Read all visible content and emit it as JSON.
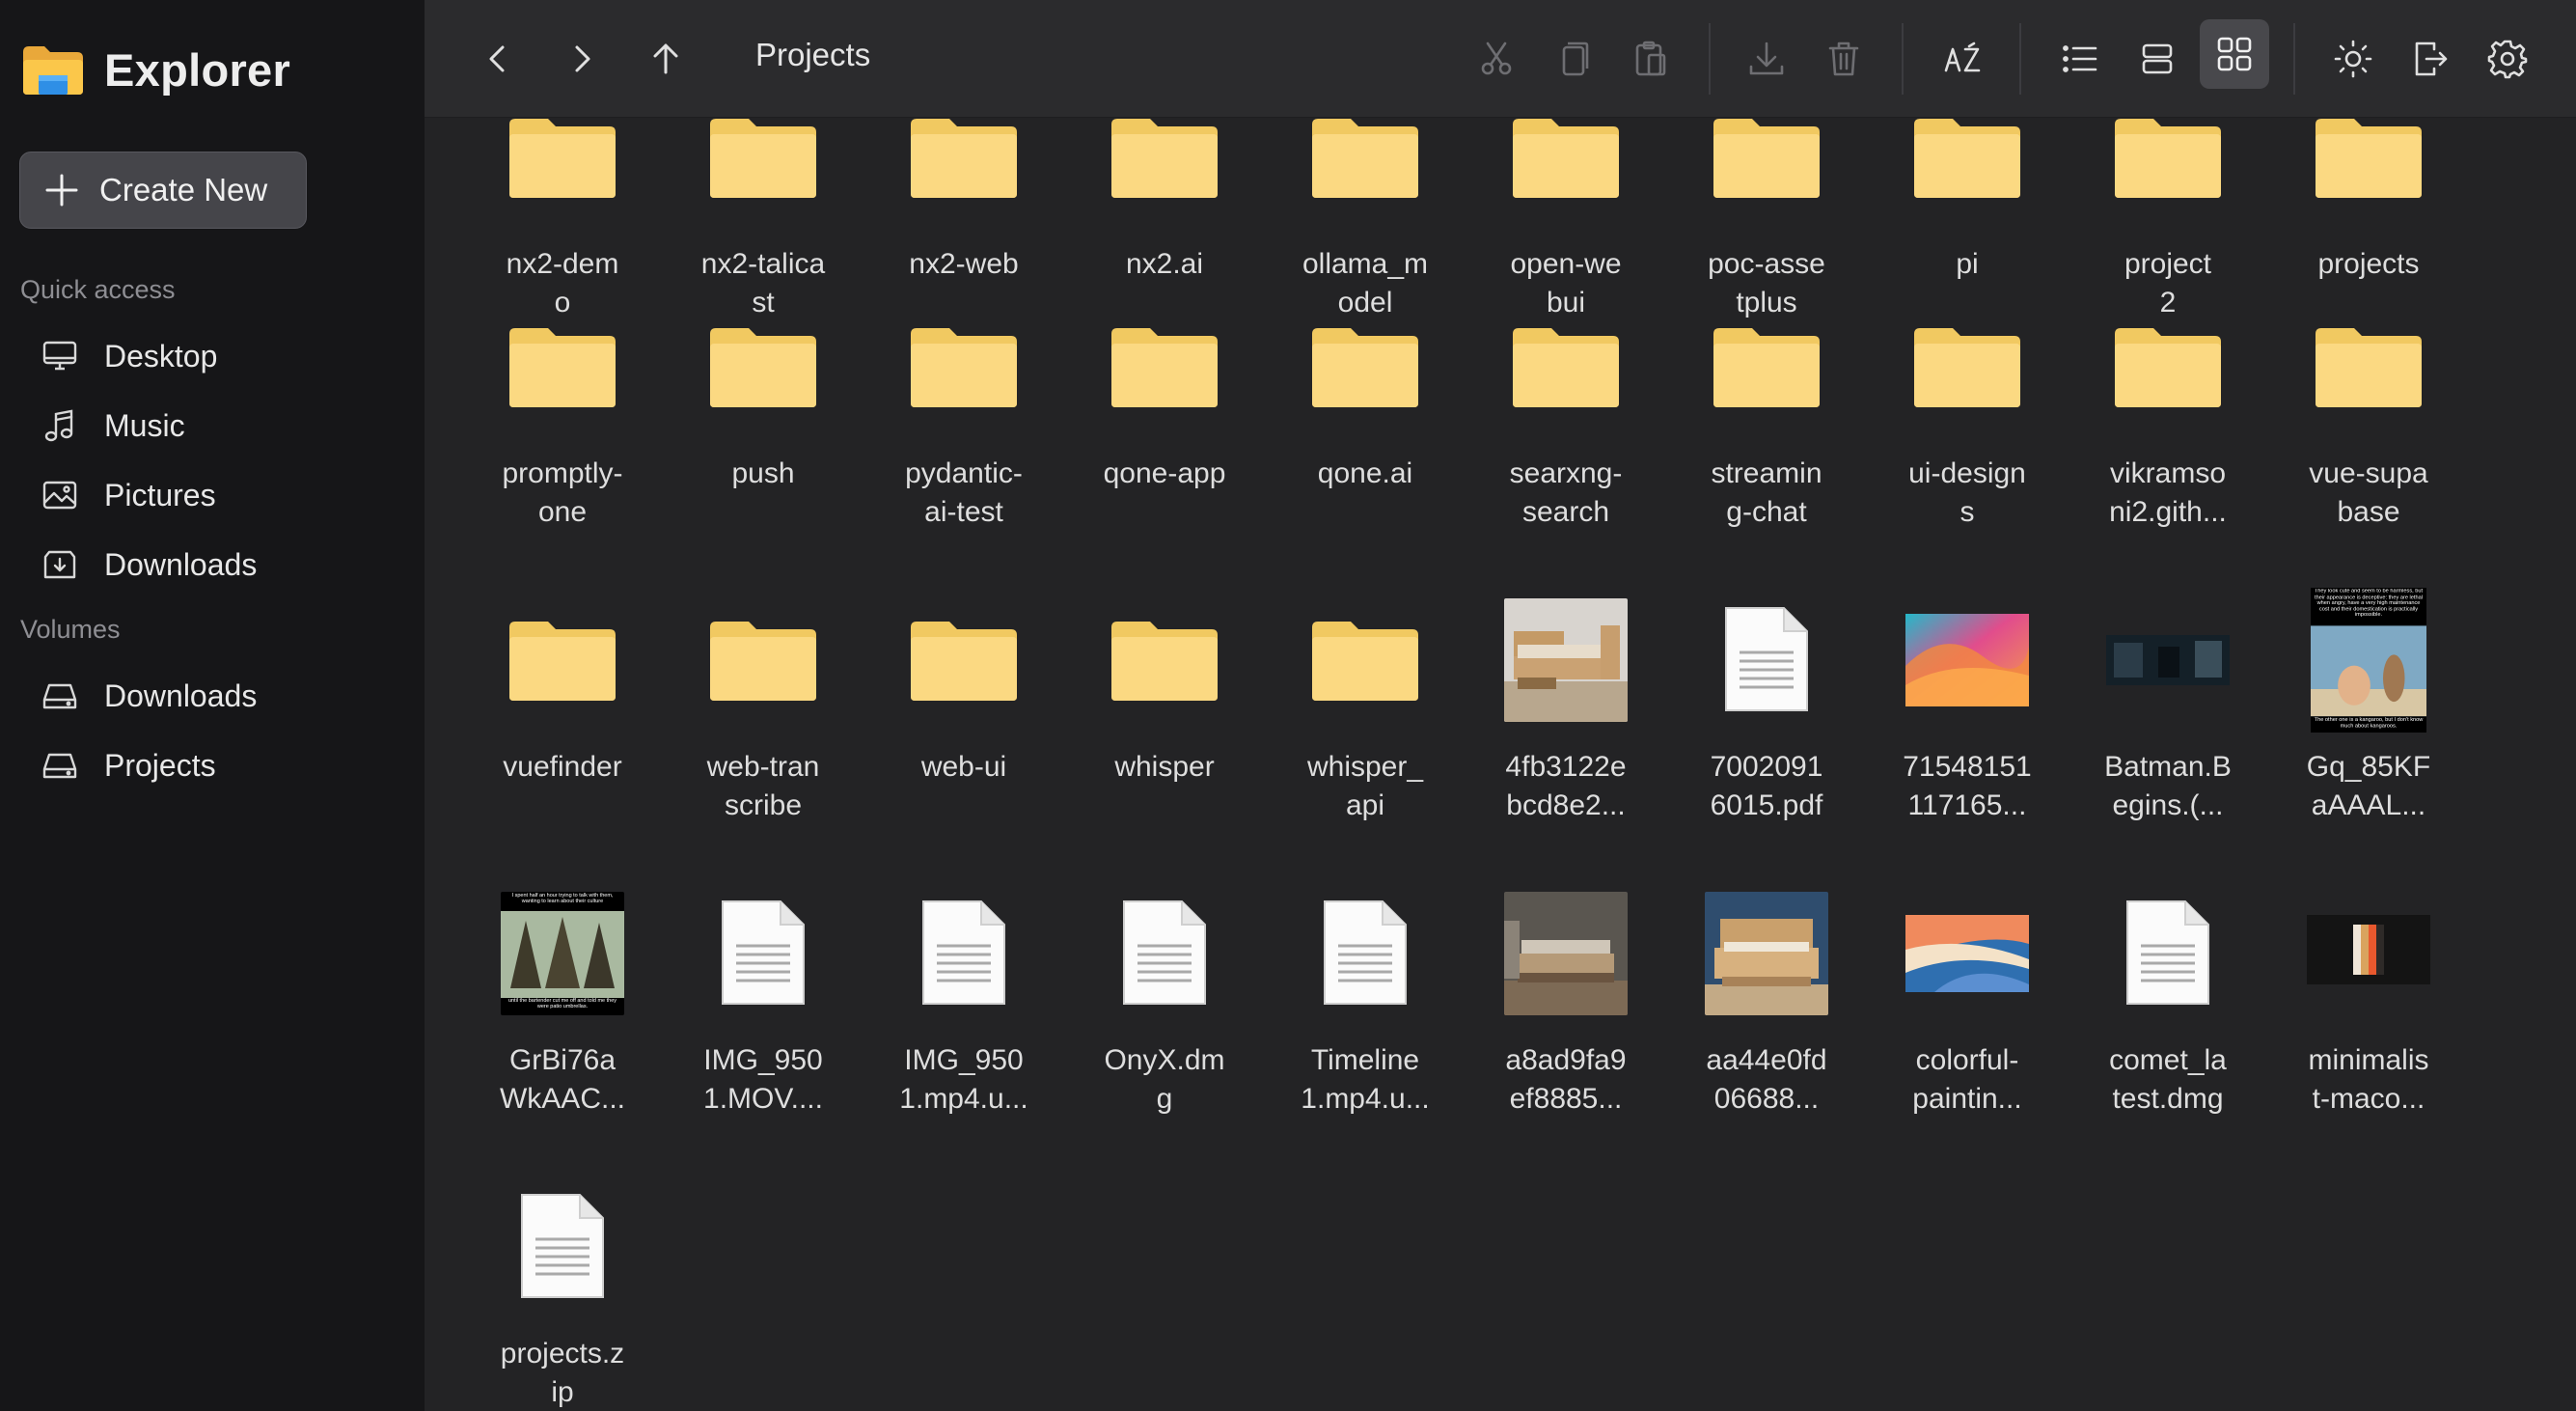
{
  "app": {
    "title": "Explorer"
  },
  "sidebar": {
    "create_label": "Create New",
    "quick_access_label": "Quick access",
    "volumes_label": "Volumes",
    "quick_access": [
      {
        "label": "Desktop",
        "icon": "monitor-icon"
      },
      {
        "label": "Music",
        "icon": "music-icon"
      },
      {
        "label": "Pictures",
        "icon": "image-icon"
      },
      {
        "label": "Downloads",
        "icon": "download-box-icon"
      }
    ],
    "volumes": [
      {
        "label": "Downloads",
        "icon": "drive-icon"
      },
      {
        "label": "Projects",
        "icon": "drive-icon"
      }
    ]
  },
  "toolbar": {
    "path_title": "Projects",
    "buttons": [
      "back-icon",
      "forward-icon",
      "up-icon",
      "cut-icon",
      "copy-icon",
      "paste-icon",
      "download-icon",
      "trash-icon",
      "sort-az-icon",
      "list-view-icon",
      "split-view-icon",
      "grid-view-icon",
      "theme-icon",
      "logout-icon",
      "settings-icon"
    ]
  },
  "items": [
    {
      "name": "nx2-dem o",
      "kind": "folder"
    },
    {
      "name": "nx2-talica st",
      "kind": "folder"
    },
    {
      "name": "nx2-web",
      "kind": "folder"
    },
    {
      "name": "nx2.ai",
      "kind": "folder"
    },
    {
      "name": "ollama_m odel",
      "kind": "folder"
    },
    {
      "name": "open-we bui",
      "kind": "folder"
    },
    {
      "name": "poc-asse tplus",
      "kind": "folder"
    },
    {
      "name": "pi",
      "kind": "folder"
    },
    {
      "name": "project 2",
      "kind": "folder"
    },
    {
      "name": "projects",
      "kind": "folder"
    },
    {
      "name": "promptly- one",
      "kind": "folder"
    },
    {
      "name": "push",
      "kind": "folder"
    },
    {
      "name": "pydantic- ai-test",
      "kind": "folder"
    },
    {
      "name": "qone-app",
      "kind": "folder"
    },
    {
      "name": "qone.ai",
      "kind": "folder"
    },
    {
      "name": "searxng- search",
      "kind": "folder"
    },
    {
      "name": "streamin g-chat",
      "kind": "folder"
    },
    {
      "name": "ui-design s",
      "kind": "folder"
    },
    {
      "name": "vikramso ni2.gith...",
      "kind": "folder"
    },
    {
      "name": "vue-supa base",
      "kind": "folder"
    },
    {
      "name": "vuefinder",
      "kind": "folder"
    },
    {
      "name": "web-tran scribe",
      "kind": "folder"
    },
    {
      "name": "web-ui",
      "kind": "folder"
    },
    {
      "name": "whisper",
      "kind": "folder"
    },
    {
      "name": "whisper_ api",
      "kind": "folder"
    },
    {
      "name": "4fb3122e bcd8e2...",
      "kind": "image",
      "thumb": "bed-wood"
    },
    {
      "name": "7002091 6015.pdf",
      "kind": "file"
    },
    {
      "name": "71548151 117165...",
      "kind": "image",
      "thumb": "gradient-wave"
    },
    {
      "name": "Batman.B egins.(...",
      "kind": "image",
      "thumb": "dark-scene"
    },
    {
      "name": "Gq_85KF aAAAL...",
      "kind": "image",
      "thumb": "meme-kangaroo"
    },
    {
      "name": "GrBi76a WkAAC...",
      "kind": "image",
      "thumb": "meme-umbrellas"
    },
    {
      "name": "IMG_950 1.MOV....",
      "kind": "file"
    },
    {
      "name": "IMG_950 1.mp4.u...",
      "kind": "file"
    },
    {
      "name": "OnyX.dm g",
      "kind": "file"
    },
    {
      "name": "Timeline 1.mp4.u...",
      "kind": "file"
    },
    {
      "name": "a8ad9fa9 ef8885...",
      "kind": "image",
      "thumb": "bedroom"
    },
    {
      "name": "aa44e0fd 06688...",
      "kind": "image",
      "thumb": "bed-blue"
    },
    {
      "name": "colorful- paintin...",
      "kind": "image",
      "thumb": "colorful-painting"
    },
    {
      "name": "comet_la test.dmg",
      "kind": "file"
    },
    {
      "name": "minimalis t-maco...",
      "kind": "image",
      "thumb": "macos-minimal"
    },
    {
      "name": "projects.z ip",
      "kind": "file"
    }
  ],
  "thumb_text": {
    "meme_kangaroo_top": "They look cute and seem to be harmless, but their appearance is deceptive: they are lethal when angry, have a very high maintenance cost and their domestication is practically impossible.",
    "meme_kangaroo_bottom": "The other one is a kangaroo, but I don't know much about kangaroos.",
    "meme_umbrella_top": "I spent half an hour trying to talk with them, wanting to learn about their culture",
    "meme_umbrella_bottom": "until the bartender cut me off and told me they were patio umbrellas."
  },
  "colors": {
    "sidebar_bg": "#161618",
    "main_bg": "#232325",
    "folder": "#f9d77e",
    "accent_active": "#48484c"
  }
}
